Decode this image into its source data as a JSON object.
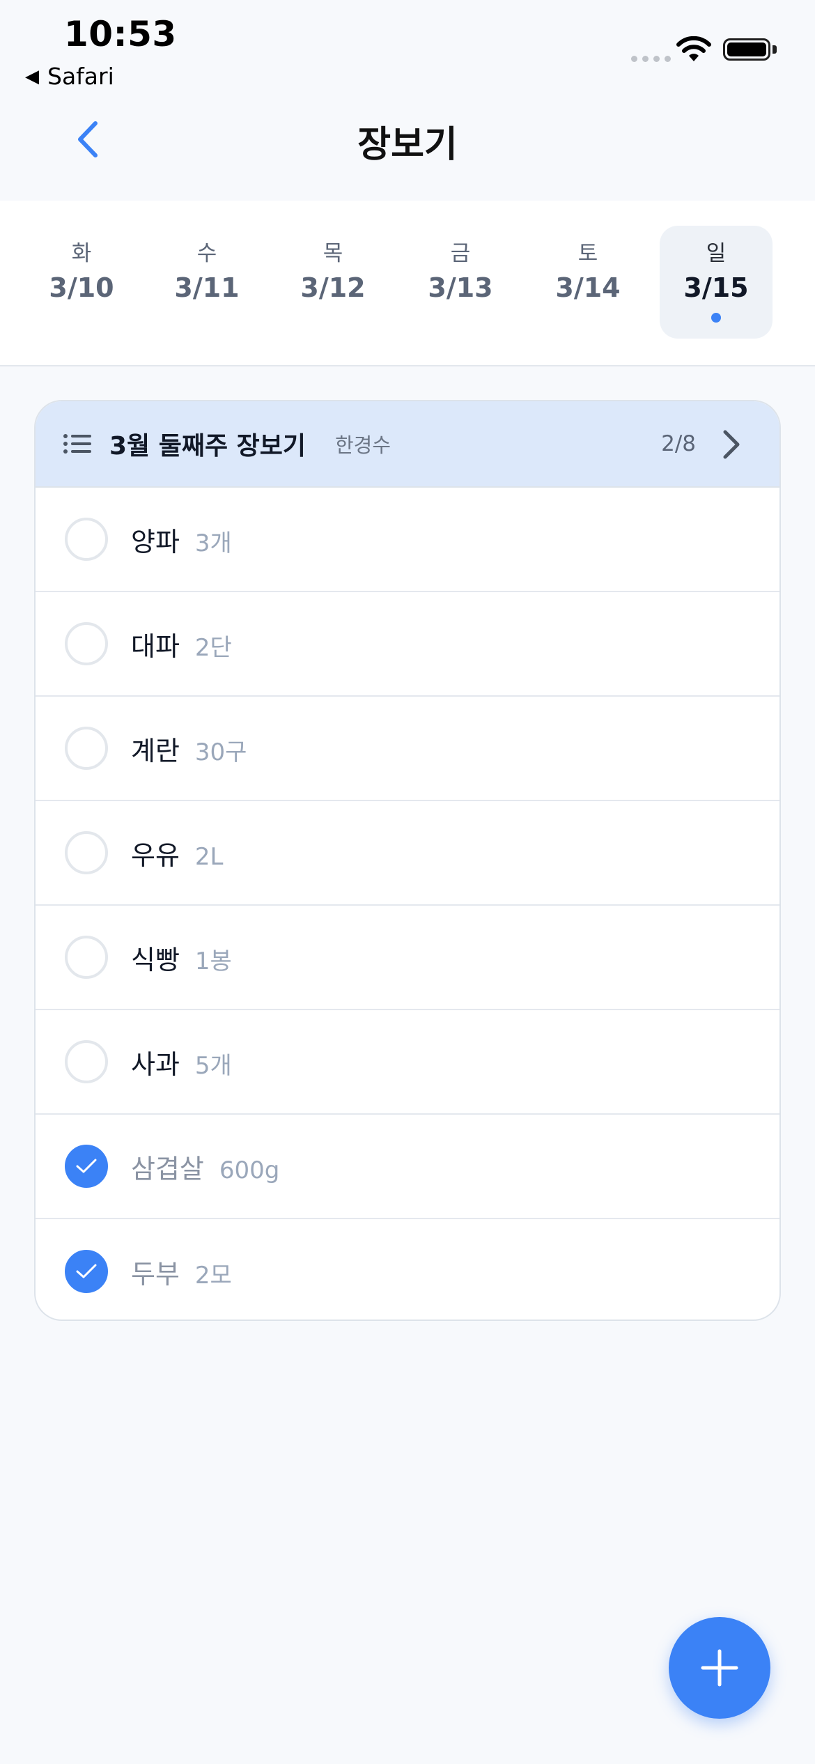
{
  "status": {
    "time": "10:53",
    "back_app": "Safari"
  },
  "nav": {
    "title": "장보기",
    "back_icon": "chevron-left-icon"
  },
  "colors": {
    "accent": "#3B82F6",
    "header_bg": "#DCE8FA",
    "page_bg": "#F7F9FC"
  },
  "days": [
    {
      "dow": "화",
      "date": "3/10"
    },
    {
      "dow": "수",
      "date": "3/11"
    },
    {
      "dow": "목",
      "date": "3/12"
    },
    {
      "dow": "금",
      "date": "3/13"
    },
    {
      "dow": "토",
      "date": "3/14"
    },
    {
      "dow": "일",
      "date": "3/15",
      "selected": true
    }
  ],
  "list": {
    "title": "3월 둘째주 장보기",
    "owner": "한경수",
    "count": "2/8",
    "items": [
      {
        "name": "양파",
        "qty": "3개",
        "checked": false
      },
      {
        "name": "대파",
        "qty": "2단",
        "checked": false
      },
      {
        "name": "계란",
        "qty": "30구",
        "checked": false
      },
      {
        "name": "우유",
        "qty": "2L",
        "checked": false
      },
      {
        "name": "식빵",
        "qty": "1봉",
        "checked": false
      },
      {
        "name": "사과",
        "qty": "5개",
        "checked": false
      },
      {
        "name": "삼겹살",
        "qty": "600g",
        "checked": true
      },
      {
        "name": "두부",
        "qty": "2모",
        "checked": true
      }
    ]
  },
  "fab": {
    "icon": "plus-icon"
  }
}
